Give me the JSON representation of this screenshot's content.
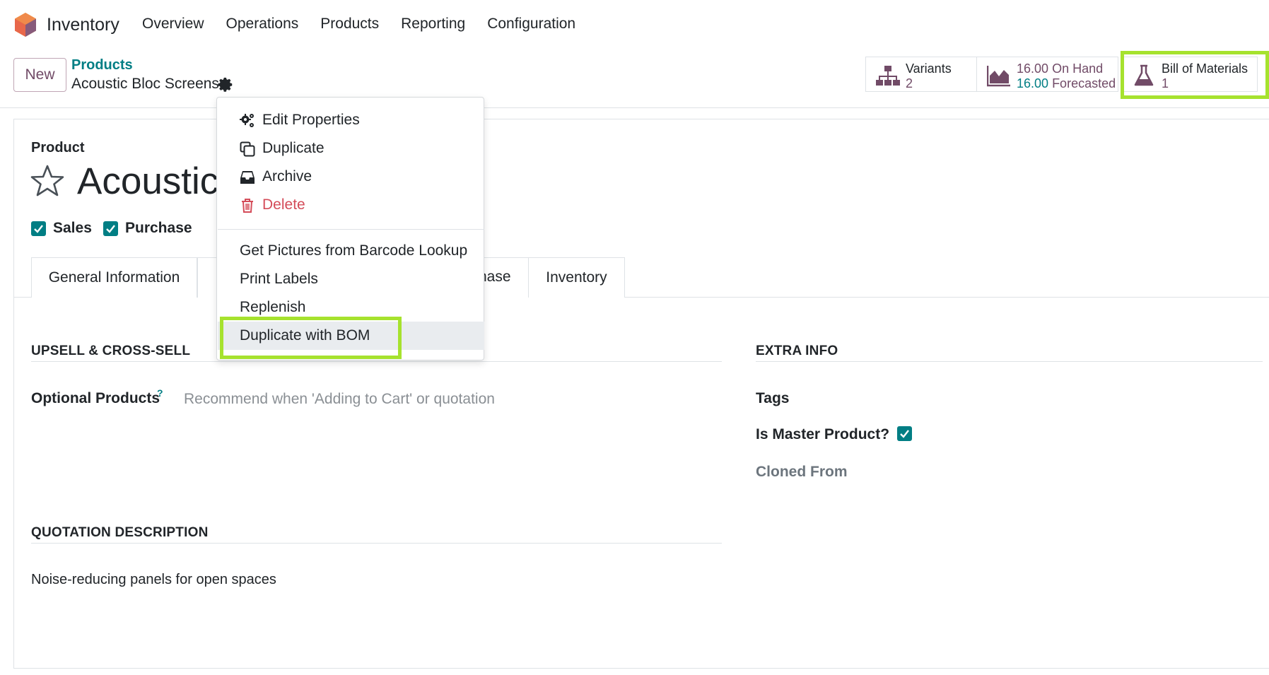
{
  "navbar": {
    "app_name": "Inventory",
    "menu": [
      "Overview",
      "Operations",
      "Products",
      "Reporting",
      "Configuration"
    ]
  },
  "control_panel": {
    "new_label": "New",
    "breadcrumb_parent": "Products",
    "breadcrumb_current": "Acoustic Bloc Screens"
  },
  "smart_buttons": {
    "variants": {
      "label": "Variants",
      "count": "2"
    },
    "on_hand": {
      "value": "16.00",
      "label": "On Hand",
      "forecast_value": "16.00",
      "forecast_label": "Forecasted"
    },
    "bom": {
      "label": "Bill of Materials",
      "count": "1"
    }
  },
  "form": {
    "product_label": "Product",
    "product_name": "Acoustic",
    "sales_label": "Sales",
    "purchase_label": "Purchase",
    "tabs": [
      "General Information",
      "hase",
      "Inventory"
    ],
    "upsell_title": "UPSELL & CROSS-SELL",
    "optional_products_label": "Optional Products",
    "optional_products_help": "?",
    "optional_products_placeholder": "Recommend when 'Adding to Cart' or quotation",
    "extra_info_title": "EXTRA INFO",
    "tags_label": "Tags",
    "is_master_label": "Is Master Product?",
    "cloned_from_label": "Cloned From",
    "quotation_title": "QUOTATION DESCRIPTION",
    "quotation_text": "Noise-reducing panels for open spaces"
  },
  "dropdown": {
    "edit_properties": "Edit Properties",
    "duplicate": "Duplicate",
    "archive": "Archive",
    "delete": "Delete",
    "get_pictures": "Get Pictures from Barcode Lookup",
    "print_labels": "Print Labels",
    "replenish": "Replenish",
    "duplicate_bom": "Duplicate with BOM"
  },
  "colors": {
    "brand": "#714b67",
    "teal": "#017e84",
    "highlight": "#a6e22e",
    "danger": "#d44c59"
  }
}
